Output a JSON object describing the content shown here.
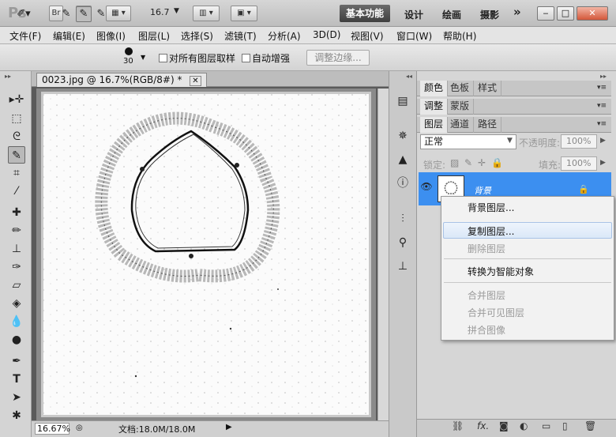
{
  "titlebar": {
    "logo": "Ps",
    "bridge_label": "Br",
    "minibridge_label": "Mb",
    "zoom_value": "16.7",
    "workspaces": [
      "基本功能",
      "设计",
      "绘画",
      "摄影"
    ],
    "more": "»",
    "min": "‒",
    "max": "□",
    "close": "✕"
  },
  "menubar": {
    "items": [
      "文件(F)",
      "编辑(E)",
      "图像(I)",
      "图层(L)",
      "选择(S)",
      "滤镜(T)",
      "分析(A)",
      "3D(D)",
      "视图(V)",
      "窗口(W)",
      "帮助(H)"
    ]
  },
  "options": {
    "brush_size": "30",
    "sample_all_label": "对所有图层取样",
    "auto_enhance_label": "自动增强",
    "refine_edge_label": "调整边缘..."
  },
  "document": {
    "tab_title": "0023.jpg @ 16.7%(RGB/8#) *",
    "tab_close": "✕",
    "status_zoom": "16.67%",
    "status_doc": "文档:18.0M/18.0M"
  },
  "panels": {
    "group1_tabs": [
      "颜色",
      "色板",
      "样式"
    ],
    "group2_tabs": [
      "调整",
      "蒙版"
    ],
    "layers_tabs": [
      "图层",
      "通道",
      "路径"
    ],
    "blend_mode": "正常",
    "opacity_label": "不透明度:",
    "opacity_value": "100%",
    "lock_label": "锁定:",
    "fill_label": "填充:",
    "fill_value": "100%",
    "layer_name": "背景"
  },
  "context_menu": {
    "items": [
      {
        "label": "背景图层...",
        "enabled": true
      },
      {
        "label": "复制图层...",
        "enabled": true
      },
      {
        "label": "删除图层",
        "enabled": false
      },
      {
        "label": "转换为智能对象",
        "enabled": true
      },
      {
        "label": "合并图层",
        "enabled": false
      },
      {
        "label": "合并可见图层",
        "enabled": false
      },
      {
        "label": "拼合图像",
        "enabled": false
      }
    ]
  },
  "colors": {
    "selected_layer": "#3c8ff0",
    "workspace_active": "#4a4a4a"
  }
}
